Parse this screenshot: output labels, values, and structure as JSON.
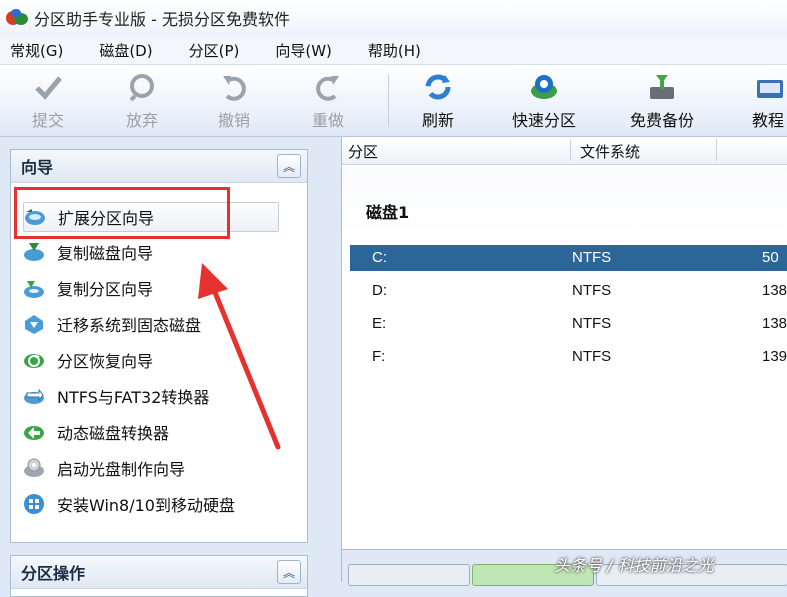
{
  "window": {
    "title": "分区助手专业版 - 无损分区免费软件"
  },
  "menu": [
    "常规(G)",
    "磁盘(D)",
    "分区(P)",
    "向导(W)",
    "帮助(H)"
  ],
  "toolbar": {
    "submit": "提交",
    "discard": "放弃",
    "undo": "撤销",
    "redo": "重做",
    "refresh": "刷新",
    "quick_partition": "快速分区",
    "free_backup": "免费备份",
    "tutorial": "教程"
  },
  "wizard_panel": {
    "title": "向导",
    "items": [
      "扩展分区向导",
      "复制磁盘向导",
      "复制分区向导",
      "迁移系统到固态磁盘",
      "分区恢复向导",
      "NTFS与FAT32转换器",
      "动态磁盘转换器",
      "启动光盘制作向导",
      "安装Win8/10到移动硬盘"
    ]
  },
  "partition_ops_panel": {
    "title": "分区操作"
  },
  "table": {
    "headers": [
      "分区",
      "文件系统"
    ],
    "disk_name": "磁盘1",
    "rows": [
      {
        "partition": "C:",
        "fs": "NTFS",
        "size": "50"
      },
      {
        "partition": "D:",
        "fs": "NTFS",
        "size": "138"
      },
      {
        "partition": "E:",
        "fs": "NTFS",
        "size": "138"
      },
      {
        "partition": "F:",
        "fs": "NTFS",
        "size": "139"
      }
    ]
  },
  "watermark": "头条号 / 科技前沿之光",
  "colors": {
    "selected_row": "#2c6699",
    "annotation": "#e6322f"
  }
}
